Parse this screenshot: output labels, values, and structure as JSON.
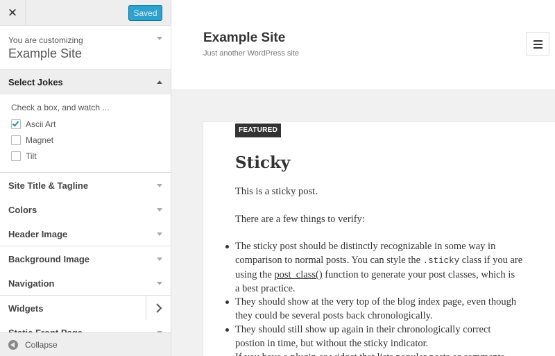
{
  "sidebar": {
    "close_icon": "close-icon",
    "saved_label": "Saved",
    "customizing_label": "You are customizing",
    "site_name": "Example Site",
    "jokes_section": {
      "title": "Select Jokes",
      "description": "Check a box, and watch ...",
      "options": [
        {
          "label": "Ascii Art",
          "checked": true
        },
        {
          "label": "Magnet",
          "checked": false
        },
        {
          "label": "Tilt",
          "checked": false
        }
      ]
    },
    "sections": [
      {
        "label": "Site Title & Tagline"
      },
      {
        "label": "Colors"
      },
      {
        "label": "Header Image"
      },
      {
        "label": "Background Image"
      },
      {
        "label": "Navigation"
      },
      {
        "label": "Widgets"
      },
      {
        "label": "Static Front Page"
      }
    ],
    "collapse_label": "Collapse"
  },
  "preview": {
    "site_title": "Example Site",
    "tagline": "Just another WordPress site",
    "menu_icon": "hamburger-menu-icon",
    "post": {
      "badge": "FEATURED",
      "title": "Sticky",
      "para1": "This is a sticky post.",
      "para2": "There are a few things to verify:",
      "b1_l1_a": "The sticky post should be distinctly recognizable in some way in",
      "b1_l2_a": "comparison to normal posts. You can style the ",
      "b1_l2_code": ".sticky",
      "b1_l2_b": " class if you are",
      "b1_l3_a": "using the ",
      "b1_l3_link": "post_class()",
      "b1_l3_b": " function to generate your post classes, which is",
      "b1_l4": "a best practice.",
      "b2_l1": "They should show at the very top of the blog index page, even though",
      "b2_l2": "they could be several posts back chronologically.",
      "b3_l1": "They should still show up again in their chronologically correct",
      "b3_l2": "postion in time, but without the sticky indicator.",
      "b4_l1": "If you have a plugin or widget that lists popular posts or comments,"
    }
  },
  "colors": {
    "accent": "#2ea2cc",
    "check": "#1e8cbe"
  }
}
